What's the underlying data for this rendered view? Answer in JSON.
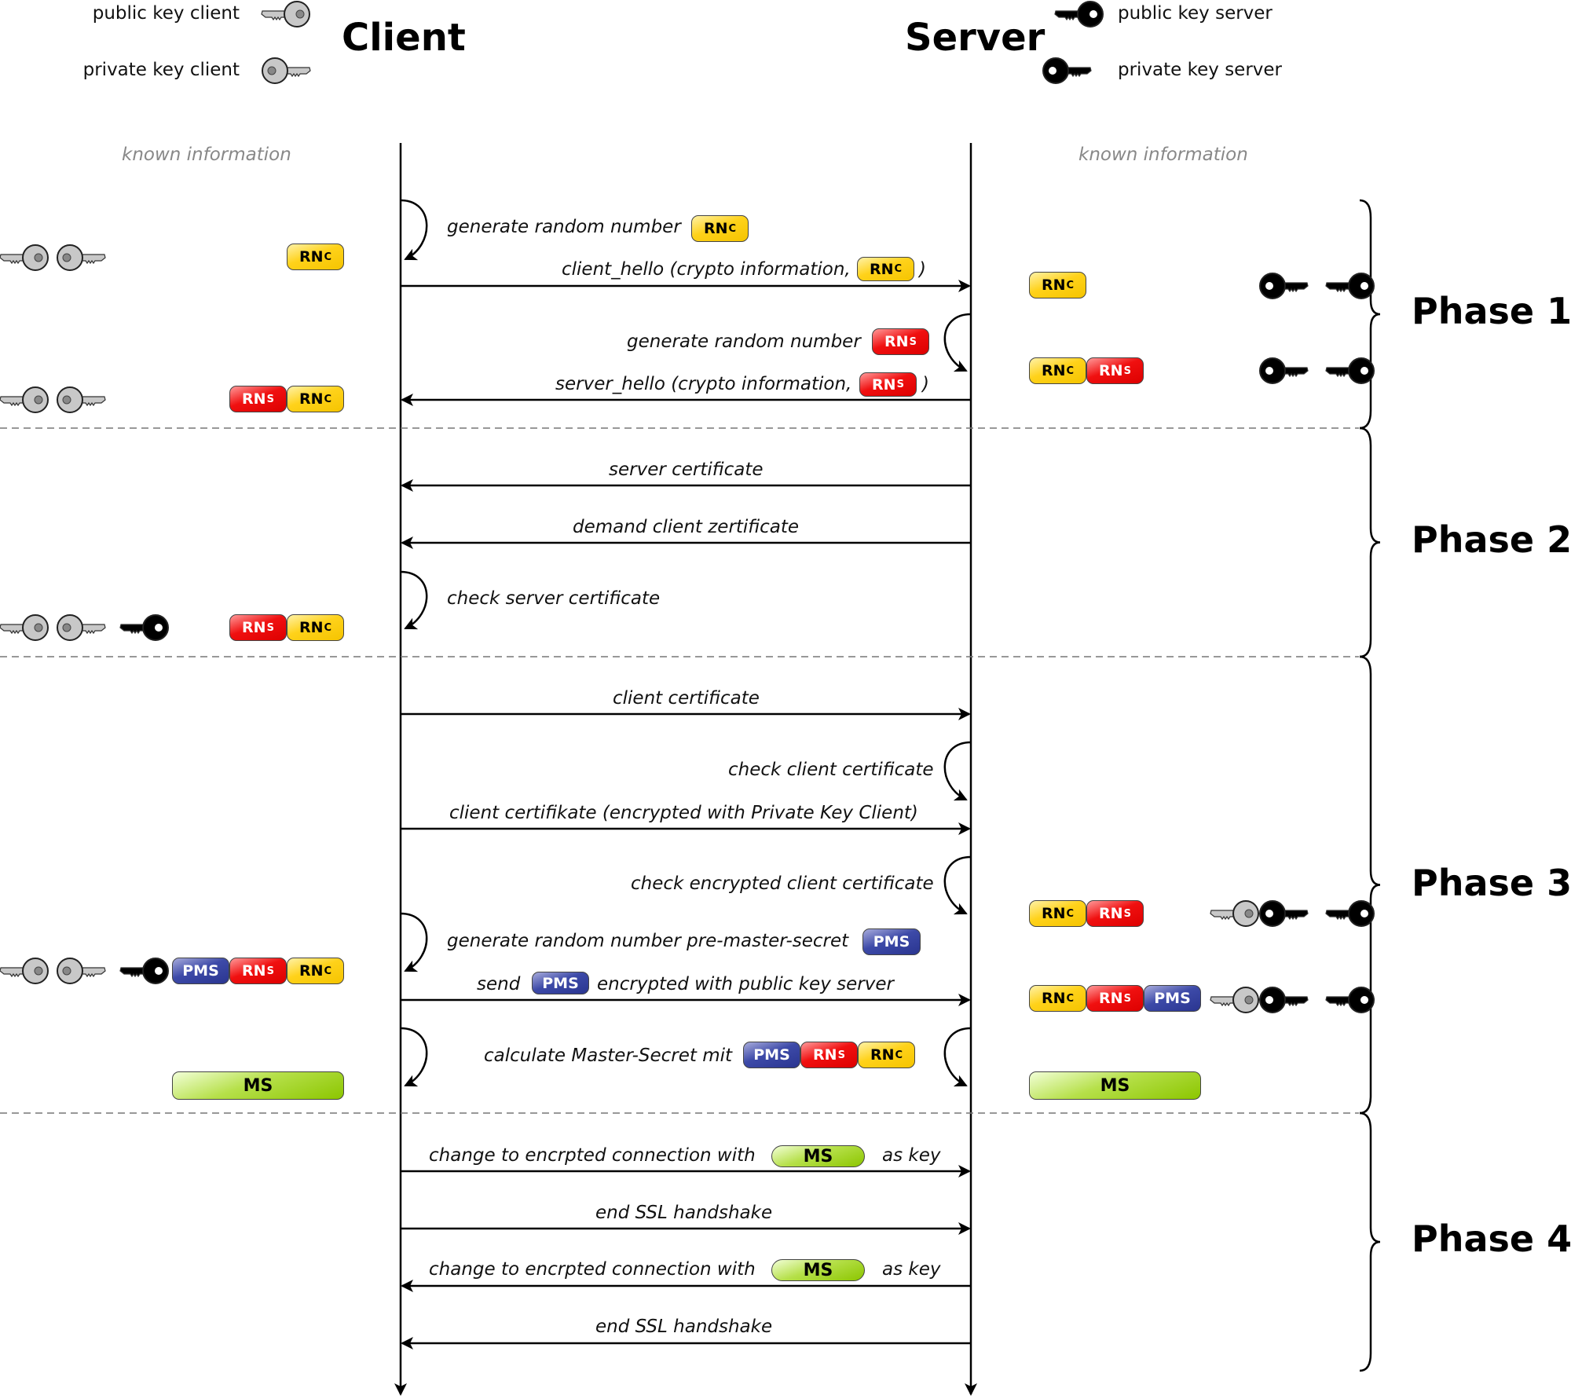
{
  "legend": {
    "public_key_client": "public key client",
    "private_key_client": "private key client",
    "public_key_server": "public key server",
    "private_key_server": "private key server"
  },
  "parties": {
    "client": "Client",
    "server": "Server"
  },
  "known_information": {
    "client": "known information",
    "server": "known information"
  },
  "tokens": {
    "rnc": {
      "label": "RN",
      "sub": "C",
      "color": "#ffd21a"
    },
    "rns": {
      "label": "RN",
      "sub": "S",
      "color": "#ee0000"
    },
    "pms": {
      "label": "PMS",
      "color": "#3d4aa8"
    },
    "ms": {
      "label": "MS",
      "color": "#9ccc10"
    }
  },
  "phases": [
    "Phase 1",
    "Phase 2",
    "Phase 3",
    "Phase 4"
  ],
  "messages": {
    "gen_rnc": "generate random number",
    "client_hello_a": "client_hello (crypto information,",
    "client_hello_b": ")",
    "gen_rns": "generate random number",
    "server_hello_a": "server_hello (crypto information,",
    "server_hello_b": ")",
    "server_cert": "server certificate",
    "demand_cert": "demand client zertificate",
    "check_server_cert": "check server certificate",
    "client_cert": "client certificate",
    "check_client_cert": "check client certificate",
    "client_cert_enc": "client certifikate (encrypted with Private Key Client)",
    "check_enc_client_cert": "check encrypted client certificate",
    "gen_pms": "generate random number pre-master-secret",
    "send_a": "send",
    "send_b": "encrypted with public key server",
    "calc_ms": "calculate Master-Secret mit",
    "change_a": "change to encrpted connection with",
    "change_b": "as key",
    "end": "end SSL handshake"
  },
  "colors": {
    "line": "#000000",
    "dash": "#777777",
    "key_client": "#c8c8c8",
    "key_server": "#000000"
  }
}
